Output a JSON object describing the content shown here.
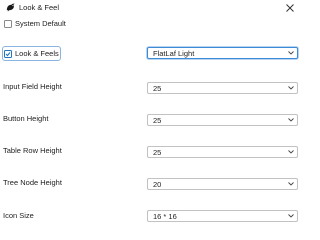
{
  "window": {
    "title": "Look & Feel",
    "icon": "bird-icon",
    "close_icon": "close-icon"
  },
  "system_default": {
    "label": "System Default",
    "checked": false
  },
  "look_and_feels": {
    "label": "Look & Feels",
    "checked": true,
    "selected": "FlatLaf Light"
  },
  "settings": [
    {
      "key": "input_field_height",
      "label": "Input Field Height",
      "value": "25"
    },
    {
      "key": "button_height",
      "label": "Button Height",
      "value": "25"
    },
    {
      "key": "table_row_height",
      "label": "Table Row Height",
      "value": "25"
    },
    {
      "key": "tree_node_height",
      "label": "Tree Node Height",
      "value": "20"
    },
    {
      "key": "icon_size",
      "label": "Icon Size",
      "value": "16 * 16"
    }
  ],
  "colors": {
    "accent": "#2675bf",
    "border": "#c2c2c2"
  }
}
